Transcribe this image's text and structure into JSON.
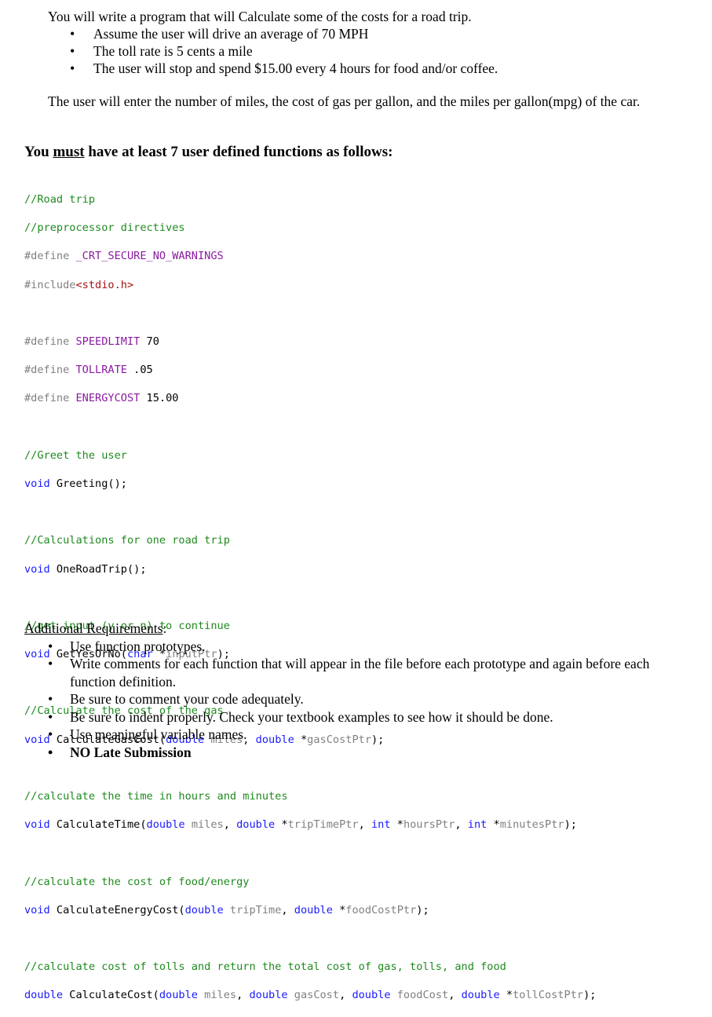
{
  "intro": {
    "lead": "You will write a program that will Calculate some of the costs for a road trip.",
    "bullets": [
      "Assume the user will drive an average of 70 MPH",
      "The toll rate is 5 cents a mile",
      "The user will stop and spend $15.00 every 4 hours for food and/or coffee."
    ],
    "input_note": "The user will enter the number of miles, the cost of gas per gallon, and the miles per gallon(mpg) of the car."
  },
  "heading": {
    "prefix": "You ",
    "emphasis": "must",
    "suffix": " have at least 7 user defined functions as follows:"
  },
  "code": {
    "comment_road_trip": "//Road trip",
    "comment_preprocessor": "//preprocessor directives",
    "define_kw": "#define ",
    "crt_macro": "_CRT_SECURE_NO_WARNINGS",
    "include_kw": "#include",
    "include_file": "<stdio.h>",
    "speed_macro": "SPEEDLIMIT",
    "speed_value": " 70",
    "toll_macro": "TOLLRATE",
    "toll_value": " .05",
    "energy_macro": "ENERGYCOST",
    "energy_value": " 15.00",
    "comment_greet": "//Greet the user",
    "comment_oneroad": "//Calculations for one road trip",
    "comment_yesno": "//get input (y or n) to continue",
    "comment_gas": "//Calculate the cost of the gas",
    "comment_time": "//calculate the time in hours and minutes",
    "comment_energy": "//calculate the cost of food/energy",
    "comment_cost": "//calculate cost of tolls and return the total cost of gas, tolls, and food",
    "kw_void": "void",
    "kw_double": "double",
    "kw_char": "char",
    "kw_int": "int",
    "fn_greeting": " Greeting();",
    "fn_oneroad": " OneRoadTrip();",
    "fn_yesno": " GetYesOrNo(",
    "fn_gas": " CalculateGasCost(",
    "fn_time": " CalculateTime(",
    "fn_energy": " CalculateEnergyCost(",
    "fn_cost": " CalculateCost(",
    "p_inputPtr": "inputPtr",
    "p_miles": "miles",
    "p_gasCostPtr": "gasCostPtr",
    "p_tripTimePtr": "tripTimePtr",
    "p_hoursPtr": "hoursPtr",
    "p_minutesPtr": "minutesPtr",
    "p_tripTime": "tripTime",
    "p_foodCostPtr": "foodCostPtr",
    "p_gasCost": "gasCost",
    "p_foodCost": "foodCost",
    "p_tollCostPtr": "tollCostPtr"
  },
  "requirements": {
    "title": "Additional Requirements",
    "colon": ":",
    "items": [
      "Use function prototypes.",
      "Write comments for each function that will appear in the file before each prototype and again before each function definition.",
      "Be sure to comment your code adequately.",
      "Be sure to indent properly. Check your textbook examples to see how it should be done.",
      "Use meaningful variable names.",
      "NO Late Submission"
    ]
  }
}
